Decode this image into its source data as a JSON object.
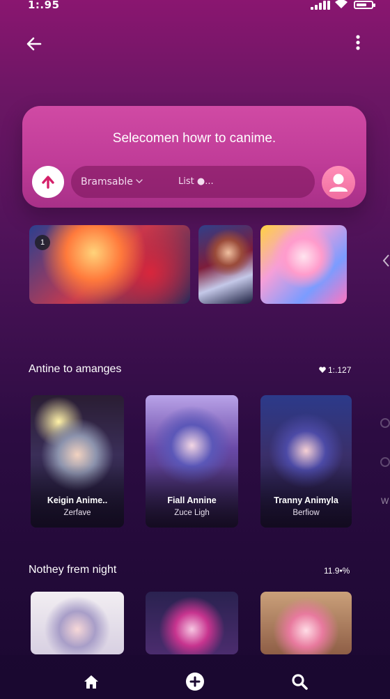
{
  "status": {
    "time": "1:.95"
  },
  "hero": {
    "title": "Selecomen howr to canime.",
    "filter_label": "Bramsable",
    "list_label": "List ●..."
  },
  "featured": {
    "badge": "1"
  },
  "section1": {
    "title": "Antine to amanges",
    "count": "1:.127",
    "cards": [
      {
        "title": "Keigin Anime..",
        "subtitle": "Zerfave"
      },
      {
        "title": "Fiall Annine",
        "subtitle": "Zuce Ligh"
      },
      {
        "title": "Tranny Animyla",
        "subtitle": "Berfiow"
      }
    ]
  },
  "section2": {
    "title": "Nothey frem night",
    "count": "11.9•%"
  },
  "edge": {
    "letter": "W"
  },
  "colors": {
    "accent": "#c03c98",
    "background": "#4a1257"
  }
}
